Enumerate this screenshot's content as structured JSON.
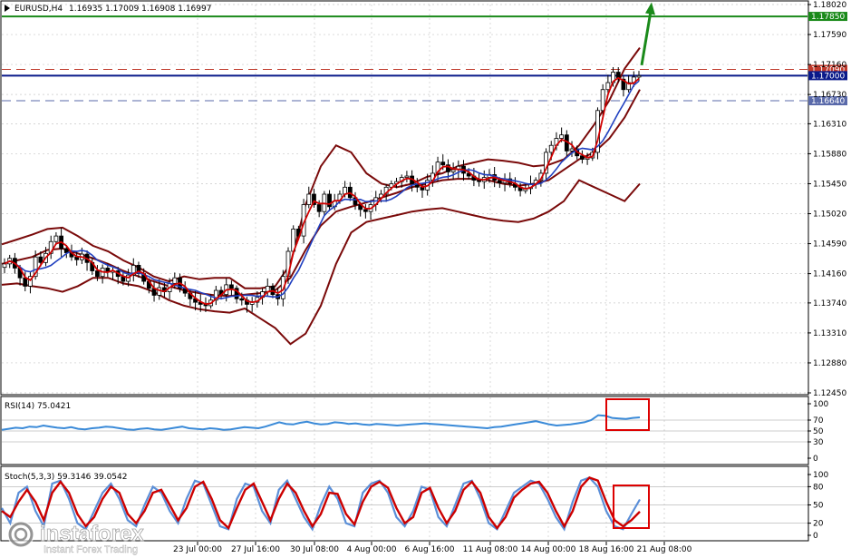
{
  "header": {
    "symbol": "EURUSD,H4",
    "ohlc": "1.16935 1.17009 1.16908 1.16997"
  },
  "rsi_title": "RSI(14) 75.0421",
  "stoch_title": "Stoch(5,3,3) 59.3146 39.0542",
  "watermark": {
    "brand": "instaforex",
    "tagline": "Instant Forex Trading"
  },
  "colors": {
    "candle": "#000000",
    "bb": "#7a0a0a",
    "ma_fast": "#d00000",
    "ma_slow": "#2040c0",
    "rsi": "#3a8ad8",
    "stoch_main": "#5b8fd8",
    "stoch_signal": "#cc0000",
    "arrow": "#1a8a1a",
    "highlight_box": "#dd0000"
  },
  "chart_data": [
    {
      "type": "candlestick",
      "panel": "price",
      "ylim": [
        1.1245,
        1.1802
      ],
      "y_ticks": [
        "1.18020",
        "1.17590",
        "1.17160",
        "1.16730",
        "1.16310",
        "1.15880",
        "1.15450",
        "1.15020",
        "1.14590",
        "1.14160",
        "1.13740",
        "1.13310",
        "1.12880",
        "1.12450"
      ],
      "x_ticks": [
        "23 Jul 00:00",
        "27 Jul 16:00",
        "30 Jul 08:00",
        "4 Aug 00:00",
        "6 Aug 16:00",
        "11 Aug 08:00",
        "14 Aug 00:00",
        "18 Aug 16:00",
        "21 Aug 08:00"
      ],
      "horizontal_levels": [
        {
          "price": 1.1785,
          "label": "1.17850",
          "style": "solid",
          "color": "#1a8a1a"
        },
        {
          "price": 1.1709,
          "label": "1.17090",
          "style": "dashed",
          "color": "#c0392b"
        },
        {
          "price": 1.17,
          "label": "1.17000",
          "style": "solid",
          "color": "#0a1a8a"
        },
        {
          "price": 1.1664,
          "label": "1.16640",
          "style": "dashed",
          "color": "#5a6aaa"
        }
      ],
      "close_path": [
        1.143,
        1.1438,
        1.1424,
        1.141,
        1.1398,
        1.1412,
        1.144,
        1.1432,
        1.1445,
        1.1462,
        1.147,
        1.1452,
        1.1446,
        1.144,
        1.1436,
        1.1444,
        1.1432,
        1.142,
        1.1412,
        1.1424,
        1.1418,
        1.142,
        1.1412,
        1.1405,
        1.1414,
        1.1428,
        1.1416,
        1.1405,
        1.1395,
        1.1385,
        1.1396,
        1.139,
        1.1402,
        1.141,
        1.1395,
        1.1388,
        1.138,
        1.1375,
        1.1372,
        1.137,
        1.1378,
        1.1392,
        1.1386,
        1.14,
        1.1395,
        1.138,
        1.1378,
        1.1372,
        1.1375,
        1.1382,
        1.139,
        1.1398,
        1.1386,
        1.138,
        1.1412,
        1.1448,
        1.148,
        1.147,
        1.1515,
        1.153,
        1.1515,
        1.1505,
        1.153,
        1.1512,
        1.152,
        1.153,
        1.154,
        1.1525,
        1.1515,
        1.1508,
        1.1505,
        1.1515,
        1.1525,
        1.153,
        1.154,
        1.1545,
        1.1548,
        1.1554,
        1.1556,
        1.1545,
        1.154,
        1.1536,
        1.155,
        1.156,
        1.1576,
        1.1572,
        1.1562,
        1.1565,
        1.157,
        1.156,
        1.1556,
        1.155,
        1.1548,
        1.1554,
        1.1558,
        1.155,
        1.1546,
        1.1552,
        1.1545,
        1.154,
        1.1535,
        1.1538,
        1.1545,
        1.155,
        1.156,
        1.159,
        1.16,
        1.161,
        1.1615,
        1.1592,
        1.1595,
        1.1585,
        1.158,
        1.1582,
        1.159,
        1.165,
        1.168,
        1.169,
        1.1705,
        1.1695,
        1.168,
        1.169,
        1.1698,
        1.17
      ],
      "bollinger": {
        "upper": [
          1.1458,
          1.1465,
          1.1472,
          1.148,
          1.1482,
          1.147,
          1.1456,
          1.1448,
          1.1435,
          1.1425,
          1.1412,
          1.1405,
          1.1412,
          1.1408,
          1.141,
          1.141,
          1.1395,
          1.1395,
          1.1398,
          1.143,
          1.1515,
          1.157,
          1.16,
          1.159,
          1.156,
          1.1545,
          1.154,
          1.1545,
          1.1555,
          1.156,
          1.157,
          1.1575,
          1.158,
          1.1578,
          1.1575,
          1.157,
          1.1572,
          1.158,
          1.16,
          1.163,
          1.1665,
          1.171,
          1.174
        ],
        "middle": [
          1.143,
          1.1435,
          1.144,
          1.145,
          1.1452,
          1.1445,
          1.1438,
          1.143,
          1.142,
          1.1412,
          1.1405,
          1.1398,
          1.1392,
          1.1388,
          1.1385,
          1.1384,
          1.1386,
          1.1388,
          1.1392,
          1.141,
          1.145,
          1.1485,
          1.1505,
          1.1512,
          1.1518,
          1.1525,
          1.1532,
          1.154,
          1.1545,
          1.155,
          1.1552,
          1.1552,
          1.155,
          1.1545,
          1.1542,
          1.1545,
          1.155,
          1.1565,
          1.158,
          1.159,
          1.161,
          1.164,
          1.168
        ],
        "lower": [
          1.14,
          1.1402,
          1.1398,
          1.1395,
          1.139,
          1.1398,
          1.141,
          1.141,
          1.1402,
          1.1398,
          1.139,
          1.1378,
          1.137,
          1.1365,
          1.1362,
          1.136,
          1.1366,
          1.1352,
          1.1338,
          1.1315,
          1.133,
          1.137,
          1.143,
          1.1475,
          1.149,
          1.1495,
          1.15,
          1.1505,
          1.1508,
          1.151,
          1.1505,
          1.15,
          1.1495,
          1.1492,
          1.149,
          1.1495,
          1.1505,
          1.152,
          1.155,
          1.154,
          1.153,
          1.152,
          1.1545
        ]
      },
      "projection_arrow": {
        "from_price": 1.1715,
        "to_price": 1.18
      }
    },
    {
      "type": "line",
      "panel": "rsi",
      "name": "RSI(14)",
      "ylim": [
        0,
        100
      ],
      "y_ticks": [
        "100",
        "70",
        "50",
        "30",
        "0"
      ],
      "values": [
        52,
        54,
        56,
        55,
        58,
        57,
        60,
        58,
        56,
        55,
        57,
        54,
        53,
        55,
        56,
        58,
        57,
        55,
        53,
        52,
        54,
        55,
        53,
        52,
        54,
        56,
        58,
        55,
        54,
        53,
        55,
        54,
        52,
        53,
        55,
        57,
        56,
        55,
        58,
        62,
        66,
        63,
        62,
        65,
        67,
        64,
        62,
        63,
        66,
        65,
        63,
        64,
        62,
        61,
        63,
        62,
        61,
        60,
        61,
        62,
        63,
        64,
        63,
        62,
        61,
        60,
        59,
        58,
        57,
        56,
        55,
        57,
        58,
        60,
        62,
        64,
        66,
        68,
        65,
        62,
        60,
        61,
        62,
        64,
        66,
        70,
        79,
        78,
        74,
        73,
        72,
        74,
        75
      ],
      "highlight": "last"
    },
    {
      "type": "line",
      "panel": "stochastic",
      "name": "Stoch(5,3,3)",
      "ylim": [
        0,
        100
      ],
      "y_ticks": [
        "100",
        "80",
        "50",
        "20",
        "0"
      ],
      "series": [
        {
          "name": "main",
          "values": [
            45,
            20,
            70,
            80,
            40,
            15,
            85,
            90,
            60,
            20,
            10,
            40,
            70,
            85,
            60,
            25,
            15,
            50,
            80,
            70,
            40,
            20,
            60,
            90,
            85,
            50,
            15,
            10,
            60,
            85,
            80,
            40,
            20,
            75,
            90,
            60,
            30,
            10,
            50,
            80,
            60,
            20,
            15,
            70,
            85,
            90,
            70,
            30,
            15,
            40,
            80,
            75,
            30,
            15,
            50,
            85,
            90,
            60,
            20,
            10,
            40,
            70,
            80,
            90,
            85,
            60,
            30,
            10,
            55,
            90,
            95,
            80,
            40,
            15,
            10,
            35,
            59
          ]
        },
        {
          "name": "signal",
          "values": [
            40,
            30,
            55,
            75,
            55,
            25,
            70,
            88,
            70,
            35,
            15,
            30,
            60,
            80,
            70,
            35,
            20,
            40,
            70,
            75,
            50,
            25,
            45,
            80,
            88,
            60,
            25,
            12,
            45,
            75,
            85,
            55,
            25,
            60,
            85,
            70,
            40,
            15,
            35,
            70,
            68,
            35,
            18,
            55,
            80,
            88,
            78,
            45,
            20,
            30,
            70,
            78,
            45,
            20,
            40,
            75,
            88,
            70,
            30,
            12,
            30,
            62,
            75,
            85,
            88,
            70,
            40,
            15,
            40,
            80,
            95,
            90,
            55,
            25,
            15,
            25,
            39
          ]
        }
      ],
      "highlight": "last"
    }
  ]
}
